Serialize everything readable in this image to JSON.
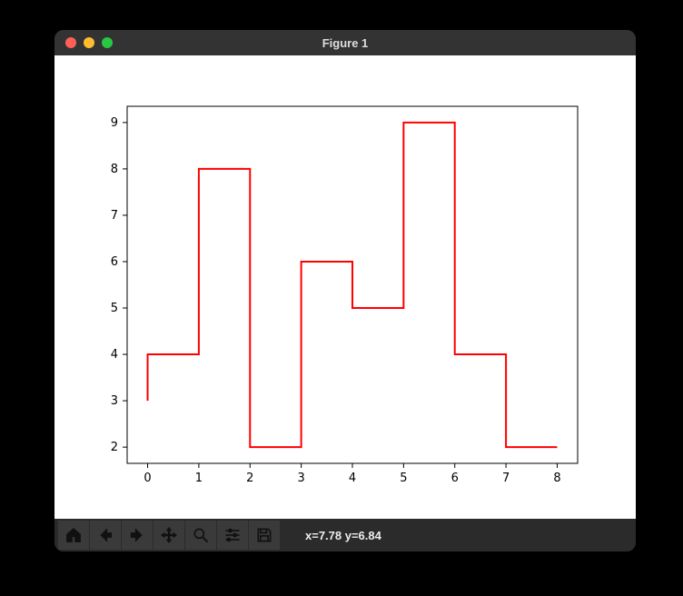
{
  "window": {
    "title": "Figure 1"
  },
  "toolbar": {
    "home": "Home",
    "back": "Back",
    "forward": "Forward",
    "pan": "Pan",
    "zoom": "Zoom",
    "subplots": "Configure subplots",
    "save": "Save"
  },
  "status": {
    "text": "x=7.78 y=6.84"
  },
  "chart_data": {
    "type": "line",
    "step": "post",
    "x": [
      0,
      1,
      2,
      3,
      4,
      5,
      6,
      7,
      8
    ],
    "y": [
      3,
      4,
      8,
      2,
      6,
      5,
      9,
      4,
      2
    ],
    "xlim": [
      -0.4,
      8.4
    ],
    "ylim": [
      1.65,
      9.35
    ],
    "xticks": [
      0,
      1,
      2,
      3,
      4,
      5,
      6,
      7,
      8
    ],
    "yticks": [
      2,
      3,
      4,
      5,
      6,
      7,
      8,
      9
    ],
    "line_color": "#ff0000",
    "title": "",
    "xlabel": "",
    "ylabel": ""
  }
}
